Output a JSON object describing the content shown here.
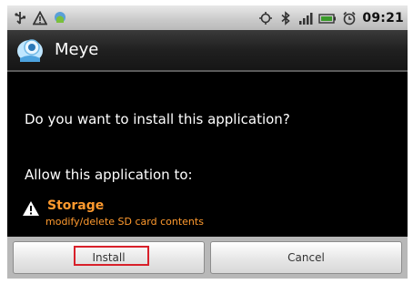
{
  "status_bar": {
    "time": "09:21",
    "left_icons": [
      "usb-icon",
      "warning-icon",
      "android-icon"
    ],
    "right_icons": [
      "gps-icon",
      "bluetooth-icon",
      "signal-icon",
      "battery-icon",
      "alarm-icon"
    ]
  },
  "header": {
    "app_name": "Meye",
    "app_icon": "camera-app-icon"
  },
  "dialog": {
    "question": "Do you want to install this application?",
    "allow_label": "Allow this application to:",
    "permissions": [
      {
        "icon": "warning-icon",
        "title": "Storage",
        "description": "modify/delete SD card contents"
      }
    ]
  },
  "buttons": {
    "install_label": "Install",
    "cancel_label": "Cancel"
  },
  "colors": {
    "permission_text": "#ff9a2e",
    "highlight_box": "#d8202a"
  }
}
